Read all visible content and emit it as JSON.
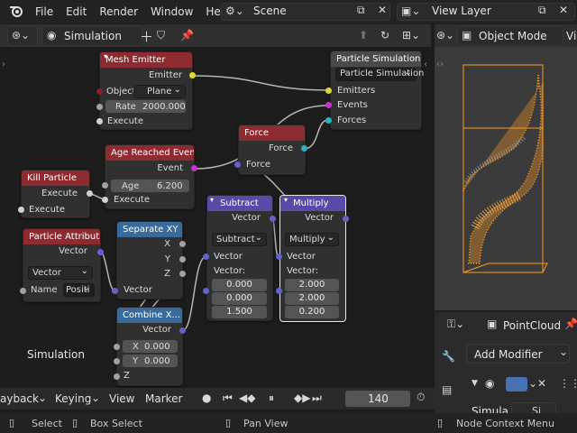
{
  "topbar": {
    "menus": [
      "File",
      "Edit",
      "Render",
      "Window",
      "Help"
    ],
    "scene": "Scene",
    "view_layer": "View Layer"
  },
  "editor_header": {
    "tree_name": "Simulation",
    "editor_type": "Simulation"
  },
  "viewport_header": {
    "mode": "Object Mode",
    "extra": "Vi"
  },
  "nodes": {
    "mesh_emitter": {
      "title": "Mesh Emitter",
      "emitter": "Emitter",
      "object_label": "Object:",
      "object_value": "Plane",
      "rate_label": "Rate",
      "rate_value": "2000.000",
      "execute": "Execute"
    },
    "particle_sim": {
      "title": "Particle Simulation",
      "name_value": "Particle Simulation",
      "emitters": "Emitters",
      "events": "Events",
      "forces": "Forces"
    },
    "force": {
      "title": "Force",
      "out": "Force",
      "in": "Force"
    },
    "age_reached": {
      "title": "Age Reached Event",
      "event": "Event",
      "age_label": "Age",
      "age_value": "6.200",
      "execute": "Execute"
    },
    "kill_particle": {
      "title": "Kill Particle",
      "execute_out": "Execute",
      "execute_in": "Execute"
    },
    "particle_attr": {
      "title": "Particle Attribut",
      "out": "Vector",
      "type": "Vector",
      "name_label": "Name",
      "name_value": "Positi"
    },
    "separate_xy": {
      "title": "Separate XY",
      "x": "X",
      "y": "Y",
      "z": "Z",
      "in": "Vector"
    },
    "combine_xyz": {
      "title": "Combine X...",
      "out": "Vector",
      "x_label": "X",
      "x_value": "0.000",
      "y_label": "Y",
      "y_value": "0.000",
      "z": "Z"
    },
    "subtract": {
      "title": "Subtract",
      "out": "Vector",
      "op": "Subtract",
      "in1": "Vector",
      "in2": "Vector:",
      "v1": "0.000",
      "v2": "0.000",
      "v3": "1.500"
    },
    "multiply": {
      "title": "Multiply",
      "out": "Vector",
      "op": "Multiply",
      "in1": "Vector",
      "in2": "Vector:",
      "v1": "2.000",
      "v2": "2.000",
      "v3": "0.200"
    }
  },
  "editor_label": "Simulation",
  "properties": {
    "object": "PointCloud",
    "add_modifier": "Add Modifier",
    "modifier_name": "Simula",
    "sub": "Si"
  },
  "timeline": {
    "playback": "ayback",
    "keying": "Keying",
    "view": "View",
    "marker": "Marker",
    "frame": "140"
  },
  "status": {
    "select": "Select",
    "box_select": "Box Select",
    "pan_view": "Pan View",
    "context_menu": "Node Context Menu"
  },
  "colors": {
    "node_red": "#8d2b31",
    "node_purple": "#5a4aa8",
    "node_blue": "#386a9b",
    "particles": "#ff9a1f"
  }
}
